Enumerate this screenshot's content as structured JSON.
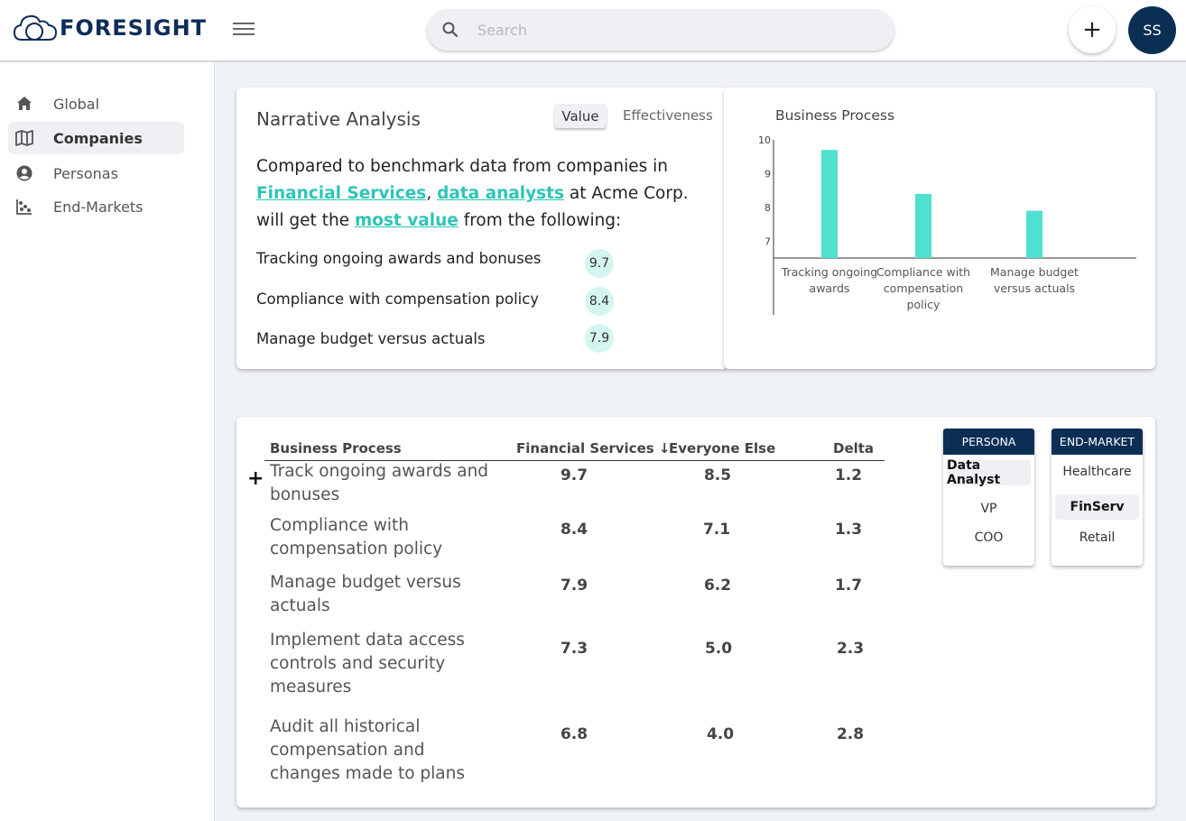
{
  "app": {
    "name": "FORESIGHT"
  },
  "header": {
    "search_placeholder": "Search",
    "add_label": "+",
    "avatar_initials": "SS"
  },
  "sidebar": {
    "items": [
      {
        "label": "Global",
        "icon": "home-icon",
        "active": false
      },
      {
        "label": "Companies",
        "icon": "map-icon",
        "active": true
      },
      {
        "label": "Personas",
        "icon": "person-icon",
        "active": false
      },
      {
        "label": "End-Markets",
        "icon": "scatter-icon",
        "active": false
      }
    ]
  },
  "narrative": {
    "title": "Narrative Analysis",
    "toggle_value": "Value",
    "toggle_effectiveness": "Effectiveness",
    "text_1": "Compared to benchmark data from companies in",
    "link_industry": "Financial Services",
    "text_comma": ",",
    "link_persona": "data analysts",
    "text_2": " at Acme Corp. will get the ",
    "link_metric": "most value",
    "text_3": " from the following:",
    "rows": [
      {
        "label": "Tracking ongoing awards and bonuses",
        "score": "9.7"
      },
      {
        "label": "Compliance with compensation policy",
        "score": "8.4"
      },
      {
        "label": "Manage budget versus actuals",
        "score": "7.9"
      }
    ]
  },
  "chart_data": {
    "type": "bar",
    "title": "Business Process",
    "categories": [
      "Tracking ongoing awards",
      "Compliance with compensation policy",
      "Manage budget versus actuals"
    ],
    "category_lines": [
      [
        "Tracking ongoing",
        "awards"
      ],
      [
        "Compliance with",
        "compensation",
        "policy"
      ],
      [
        "Manage budget",
        "versus actuals"
      ]
    ],
    "values": [
      9.7,
      8.4,
      7.9
    ],
    "yticks": [
      7,
      8,
      9,
      10
    ],
    "ylim": [
      6.5,
      10
    ],
    "color": "#4fe0cf"
  },
  "table": {
    "headers": {
      "process": "Business Process",
      "fs": "Financial Services ↓",
      "else": "Everyone Else",
      "delta": "Delta"
    },
    "expand_label": "+",
    "rows": [
      {
        "process": "Track ongoing awards and bonuses",
        "fs": "9.7",
        "else": "8.5",
        "delta": "1.2"
      },
      {
        "process": "Compliance with compensation policy",
        "fs": "8.4",
        "else": "7.1",
        "delta": "1.3"
      },
      {
        "process": "Manage budget versus actuals",
        "fs": "7.9",
        "else": "6.2",
        "delta": "1.7"
      },
      {
        "process": "Implement data access controls and security measures",
        "fs": "7.3",
        "else": "5.0",
        "delta": "2.3"
      },
      {
        "process": "Audit all historical compensation and changes made to plans",
        "fs": "6.8",
        "else": "4.0",
        "delta": "2.8"
      }
    ]
  },
  "filters": {
    "persona": {
      "title": "PERSONA",
      "options": [
        "Data Analyst",
        "VP",
        "COO"
      ],
      "selected": "Data Analyst"
    },
    "end_market": {
      "title": "END-MARKET",
      "options": [
        "Healthcare",
        "FinServ",
        "Retail"
      ],
      "selected": "FinServ"
    }
  }
}
